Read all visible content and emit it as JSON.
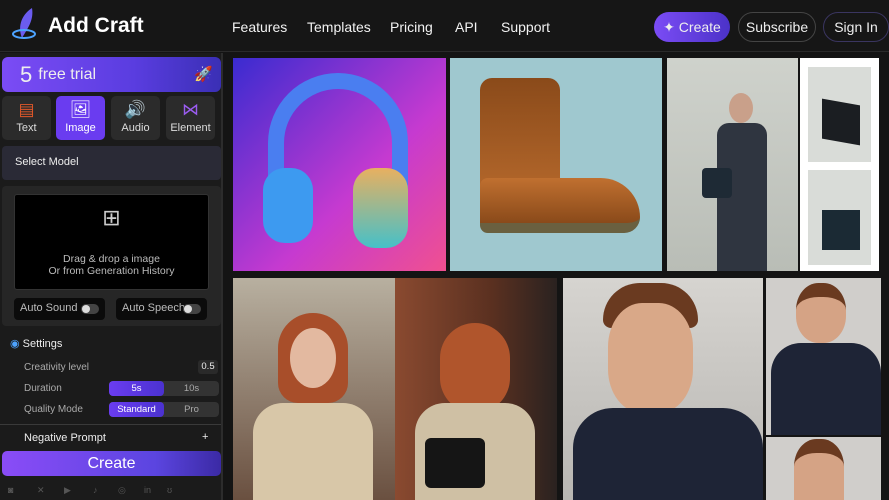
{
  "header": {
    "brand": "Add Craft",
    "nav": [
      "Features",
      "Templates",
      "Pricing",
      "API",
      "Support"
    ],
    "create": "Create",
    "subscribe": "Subscribe",
    "signin": "Sign In"
  },
  "sidebar": {
    "trial_count": "5",
    "trial_text": "free trial",
    "tabs": [
      {
        "label": "Text",
        "icon": "text-icon"
      },
      {
        "label": "Image",
        "icon": "image-icon"
      },
      {
        "label": "Audio",
        "icon": "speaker-icon"
      },
      {
        "label": "Element",
        "icon": "nodes-icon"
      }
    ],
    "active_tab": "Image",
    "select_model": "Select Model",
    "drop_line1": "Drag & drop a image",
    "drop_line2": "Or from Generation History",
    "auto_sound": "Auto Sound",
    "auto_speech": "Auto Speech",
    "settings": "Settings",
    "creativity_label": "Creativity level",
    "creativity_value": "0.5",
    "duration_label": "Duration",
    "duration_options": [
      "5s",
      "10s"
    ],
    "quality_label": "Quality Mode",
    "quality_options": [
      "Standard",
      "Pro"
    ],
    "negative_prompt": "Negative Prompt",
    "plus": "+",
    "create": "Create",
    "social": [
      "discord-icon",
      "x-icon",
      "youtube-icon",
      "tiktok-icon",
      "instagram-icon",
      "linkedin-icon",
      "bluesky-icon"
    ]
  },
  "colors": {
    "accent": "#6a3cf0",
    "bg": "#141414"
  }
}
